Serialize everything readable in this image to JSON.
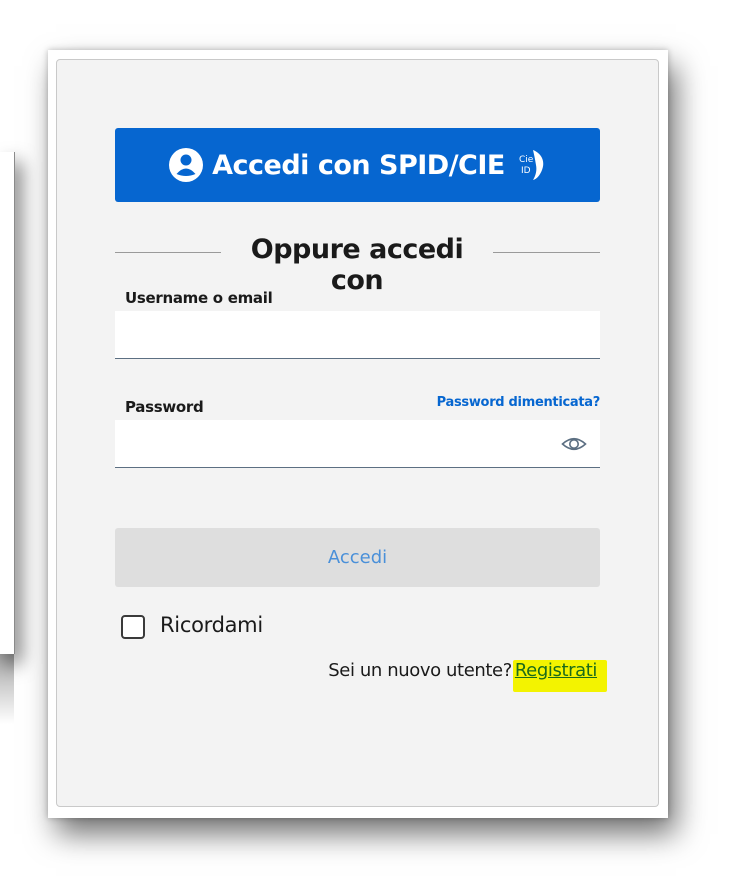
{
  "login": {
    "spid_button_label": "Accedi con SPID/CIE",
    "cie_badge_line1": "Cie",
    "cie_badge_line2": "ID",
    "divider_title": "Oppure accedi con",
    "username_label": "Username o email",
    "username_value": "",
    "password_label": "Password",
    "password_value": "",
    "forgot_password_link": "Password dimenticata?",
    "submit_button_label": "Accedi",
    "remember_label": "Ricordami",
    "remember_checked": false,
    "new_user_prompt": "Sei un nuovo utente?",
    "register_link": "Registrati"
  },
  "icons": {
    "spid": "user-circle-icon",
    "cie": "cie-id-icon",
    "password_toggle": "eye-icon"
  },
  "colors": {
    "primary_blue": "#0666d0",
    "card_background": "#f3f3f3",
    "disabled_button_bg": "#dedede",
    "disabled_button_text": "#4a90d9",
    "highlight_yellow": "#f3f300"
  }
}
